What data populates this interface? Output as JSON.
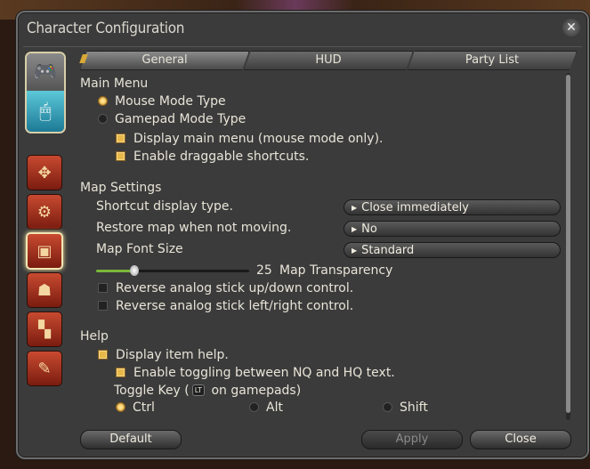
{
  "window": {
    "title": "Character Configuration"
  },
  "tabs": [
    {
      "label": "General"
    },
    {
      "label": "HUD"
    },
    {
      "label": "Party List"
    }
  ],
  "main_menu": {
    "heading": "Main Menu",
    "mouse_mode": "Mouse Mode Type",
    "gamepad_mode": "Gamepad Mode Type",
    "display_main_menu": "Display main menu (mouse mode only).",
    "enable_draggable": "Enable draggable shortcuts."
  },
  "map_settings": {
    "heading": "Map Settings",
    "shortcut_label": "Shortcut display type.",
    "shortcut_value": "Close immediately",
    "restore_label": "Restore map when not moving.",
    "restore_value": "No",
    "font_label": "Map Font Size",
    "font_value": "Standard",
    "transparency_value": "25",
    "transparency_fraction": 0.25,
    "transparency_label": "Map Transparency",
    "reverse_updown": "Reverse analog stick up/down control.",
    "reverse_leftright": "Reverse analog stick left/right control."
  },
  "help": {
    "heading": "Help",
    "display_item_help": "Display item help.",
    "enable_toggling": "Enable toggling between NQ and HQ text.",
    "toggle_key_prefix": "Toggle Key (",
    "toggle_key_badge": "LT",
    "toggle_key_suffix": " on gamepads)",
    "key_ctrl": "Ctrl",
    "key_alt": "Alt",
    "key_shift": "Shift"
  },
  "footer": {
    "default": "Default",
    "apply": "Apply",
    "close": "Close"
  },
  "colors": {
    "accent": "#e8b84a",
    "slider": "#7ab83a"
  }
}
